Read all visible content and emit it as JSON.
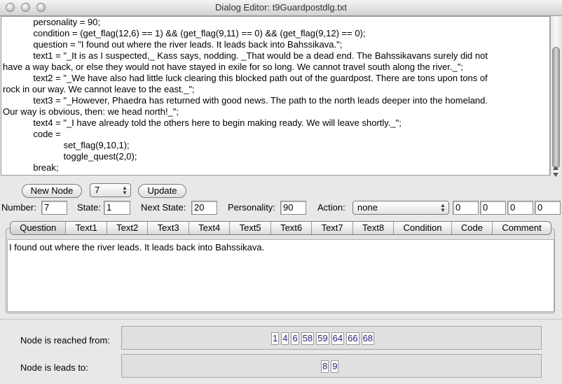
{
  "window": {
    "title": "Dialog Editor: t9Guardpostdlg.txt"
  },
  "code_lines": [
    "            personality = 90;",
    "            condition = (get_flag(12,6) == 1) && (get_flag(9,11) == 0) && (get_flag(9,12) == 0);",
    "            question = \"I found out where the river leads. It leads back into Bahssikava.\";",
    "            text1 = \"_It is as I suspected,_ Kass says, nodding. _That would be a dead end. The Bahssikavans surely did not",
    "have a way back, or else they would not have stayed in exile for so long. We cannot travel south along the river._\";",
    "            text2 = \"_We have also had little luck clearing this blocked path out of the guardpost. There are tons upon tons of",
    "rock in our way. We cannot leave to the east._\";",
    "            text3 = \"_However, Phaedra has returned with good news. The path to the north leads deeper into the homeland.",
    "Our way is obvious, then: we head north!_\";",
    "            text4 = \"_I have already told the others here to begin making ready. We will leave shortly._\";",
    "            code =",
    "                        set_flag(9,10,1);",
    "                        toggle_quest(2,0);",
    "            break;"
  ],
  "toolbar": {
    "new_node": "New Node",
    "node_select": "7",
    "update": "Update"
  },
  "fields": {
    "number_label": "Number:",
    "number_value": "7",
    "state_label": "State:",
    "state_value": "1",
    "next_state_label": "Next State:",
    "next_state_value": "20",
    "personality_label": "Personality:",
    "personality_value": "90",
    "action_label": "Action:",
    "action_value": "none",
    "action_params": [
      "0",
      "0",
      "0",
      "0"
    ]
  },
  "tabs": [
    "Question",
    "Text1",
    "Text2",
    "Text3",
    "Text4",
    "Text5",
    "Text6",
    "Text7",
    "Text8",
    "Condition",
    "Code",
    "Comment"
  ],
  "active_tab": "Question",
  "tab_content": "I found out where the river leads. It leads back into Bahssikava.",
  "reached_from": {
    "label": "Node is reached from:",
    "nodes": [
      "1",
      "4",
      "6",
      "58",
      "59",
      "64",
      "66",
      "68"
    ]
  },
  "leads_to": {
    "label": "Node is leads to:",
    "nodes": [
      "8",
      "9"
    ]
  },
  "colors": {
    "link": "#1a1ad0",
    "window_bg": "#e8e8e8"
  }
}
